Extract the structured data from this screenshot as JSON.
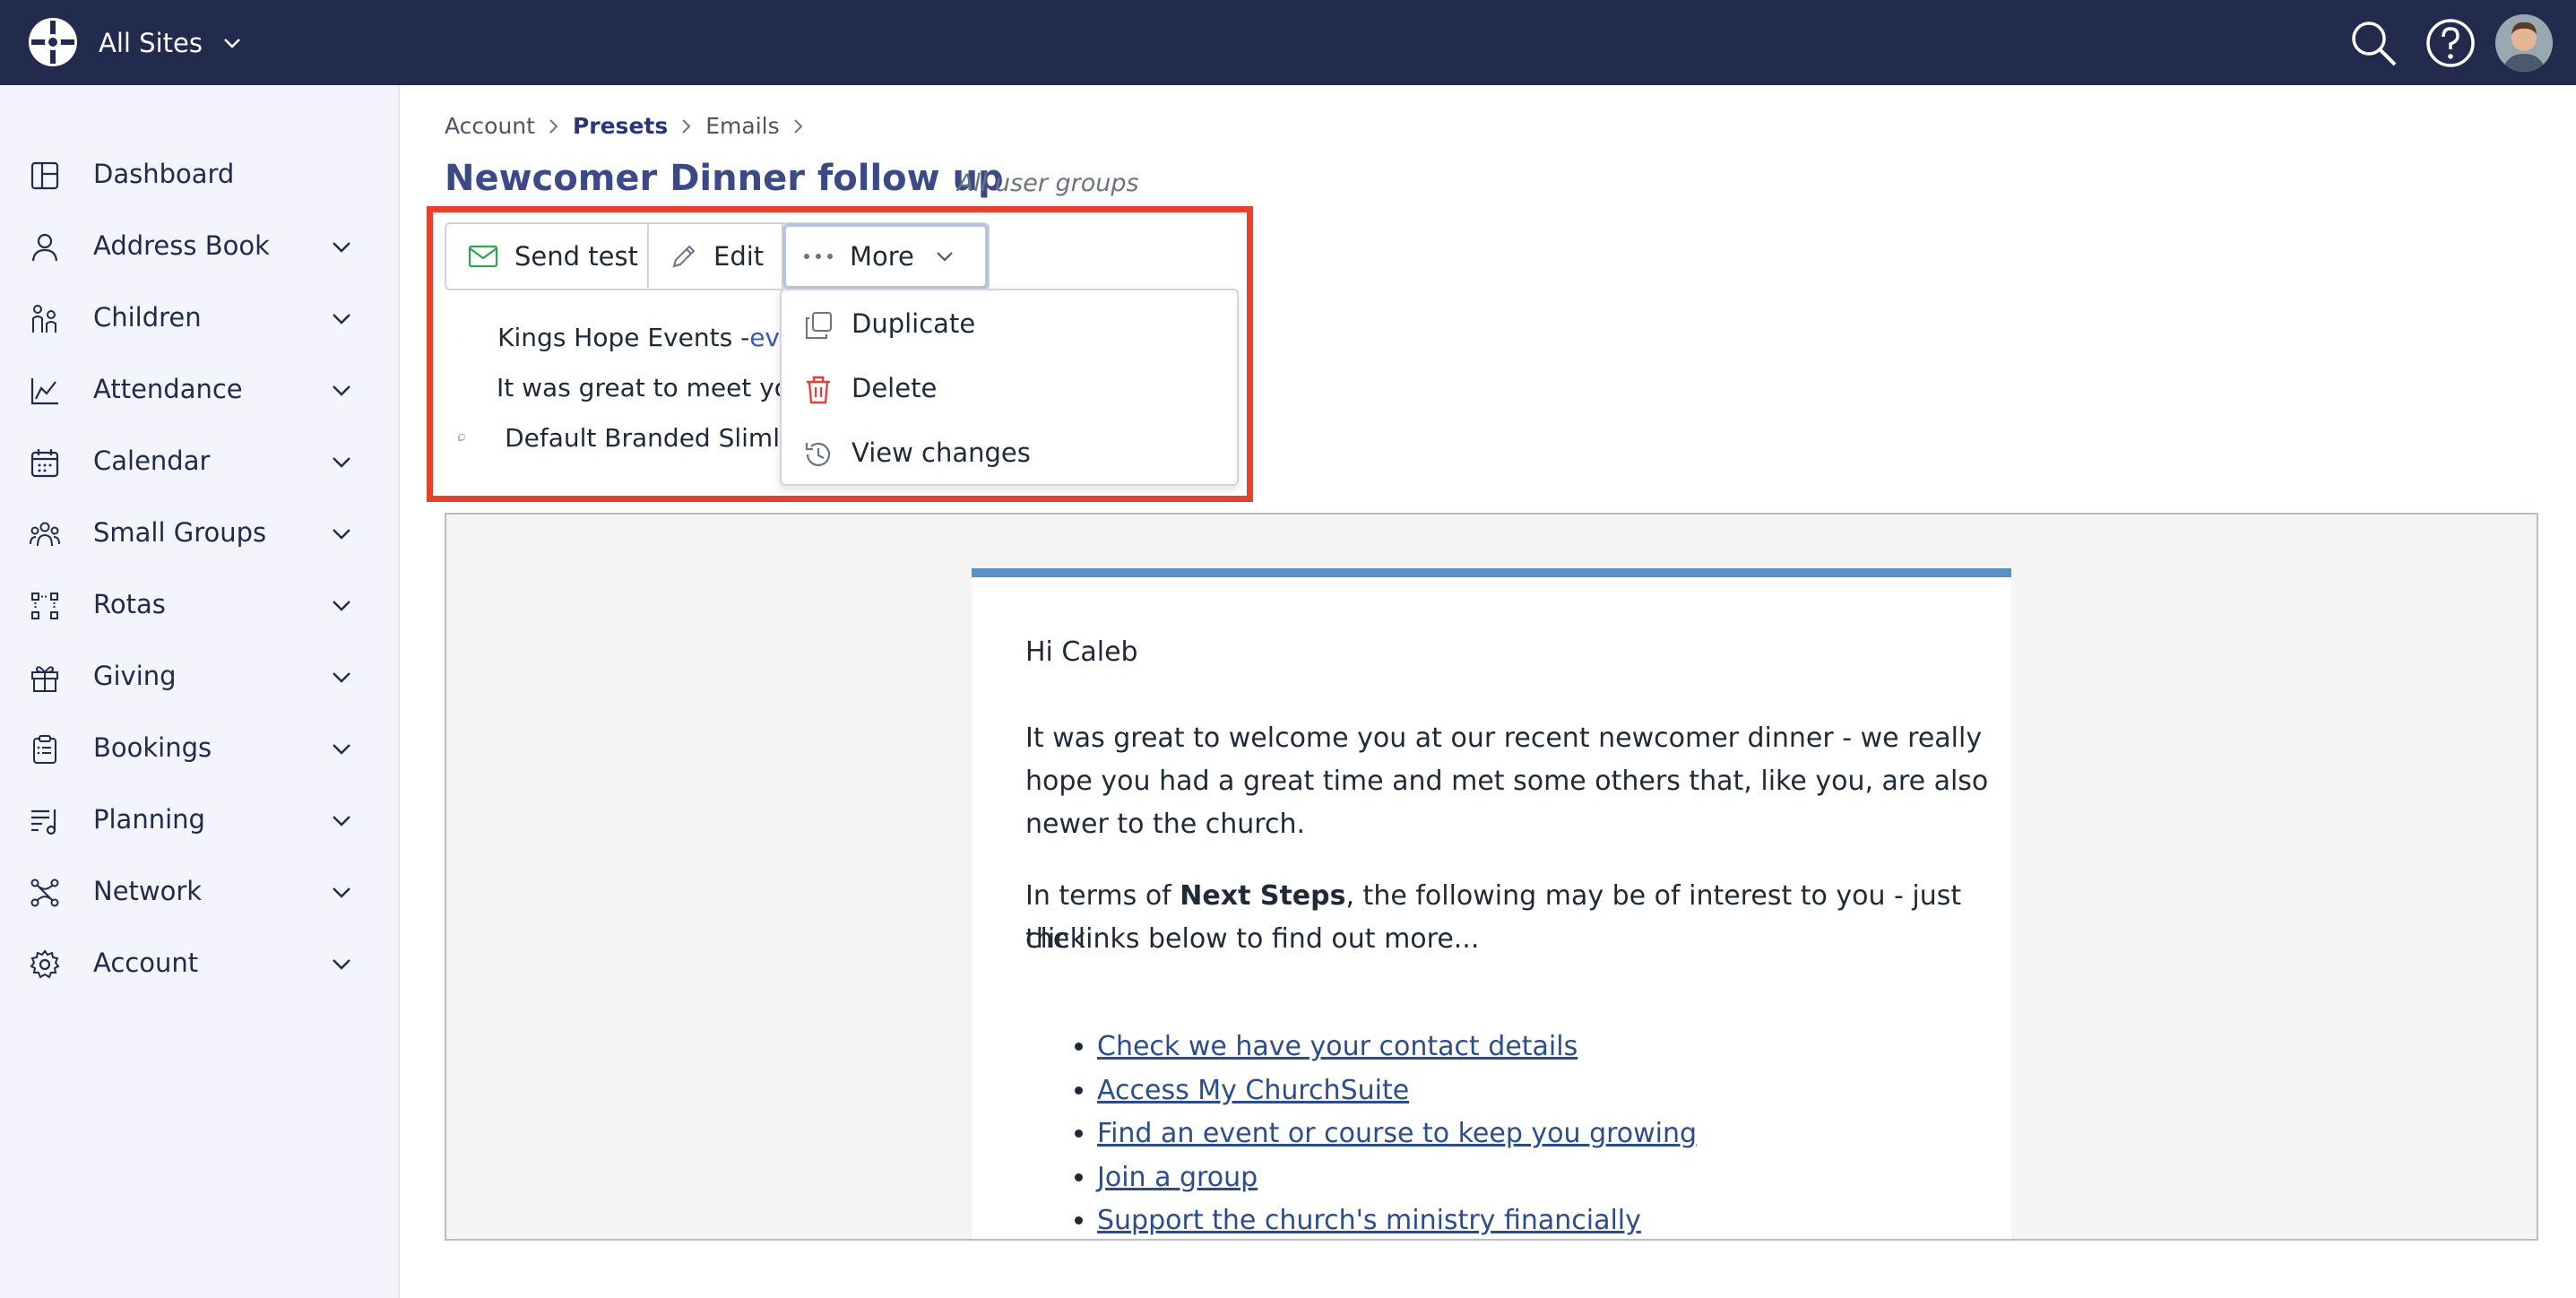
{
  "topbar": {
    "site_selector": "All Sites"
  },
  "sidebar": {
    "items": [
      {
        "label": "Dashboard",
        "icon": "dashboard-icon",
        "expandable": false
      },
      {
        "label": "Address Book",
        "icon": "person-icon",
        "expandable": true
      },
      {
        "label": "Children",
        "icon": "children-icon",
        "expandable": true
      },
      {
        "label": "Attendance",
        "icon": "chart-icon",
        "expandable": true
      },
      {
        "label": "Calendar",
        "icon": "calendar-icon",
        "expandable": true
      },
      {
        "label": "Small Groups",
        "icon": "group-icon",
        "expandable": true
      },
      {
        "label": "Rotas",
        "icon": "rotas-icon",
        "expandable": true
      },
      {
        "label": "Giving",
        "icon": "gift-icon",
        "expandable": true
      },
      {
        "label": "Bookings",
        "icon": "clipboard-icon",
        "expandable": true
      },
      {
        "label": "Planning",
        "icon": "planning-icon",
        "expandable": true
      },
      {
        "label": "Network",
        "icon": "network-icon",
        "expandable": true
      },
      {
        "label": "Account",
        "icon": "gear-icon",
        "expandable": true
      }
    ]
  },
  "breadcrumb": {
    "items": [
      "Account",
      "Presets",
      "Emails"
    ]
  },
  "page": {
    "title": "Newcomer Dinner follow up",
    "user_groups": "All user groups"
  },
  "toolbar": {
    "send_test": "Send test",
    "edit": "Edit",
    "more": "More"
  },
  "details": {
    "from_text": "Kings Hope Events - ",
    "from_link": "ev",
    "subject": "It was great to meet yo",
    "template": "Default Branded Sliml"
  },
  "more_menu": {
    "items": [
      {
        "label": "Duplicate",
        "icon": "duplicate-icon"
      },
      {
        "label": "Delete",
        "icon": "trash-icon"
      },
      {
        "label": "View changes",
        "icon": "history-icon"
      }
    ]
  },
  "email": {
    "greeting": "Hi Caleb",
    "para1_line1": "It was great to welcome you at our recent newcomer dinner -  we really",
    "para1_line2": "hope you had a great time and met some others that, like you, are also",
    "para1_line3": "newer to the church.",
    "para2_prefix": "In terms of ",
    "para2_bold": "Next Steps",
    "para2_rest": ", the following may be of interest to you - just click",
    "para2_line2": "the links below to find out more...",
    "links": [
      "Check we have your contact details",
      "Access My ChurchSuite",
      "Find an event or course to keep you growing",
      "Join a group",
      "Support the church's ministry financially"
    ]
  },
  "colors": {
    "topbar": "#222a4e",
    "sidebar_bg": "#f4f4fc",
    "highlight": "#e8402d",
    "email_accent": "#5a8fc6"
  }
}
